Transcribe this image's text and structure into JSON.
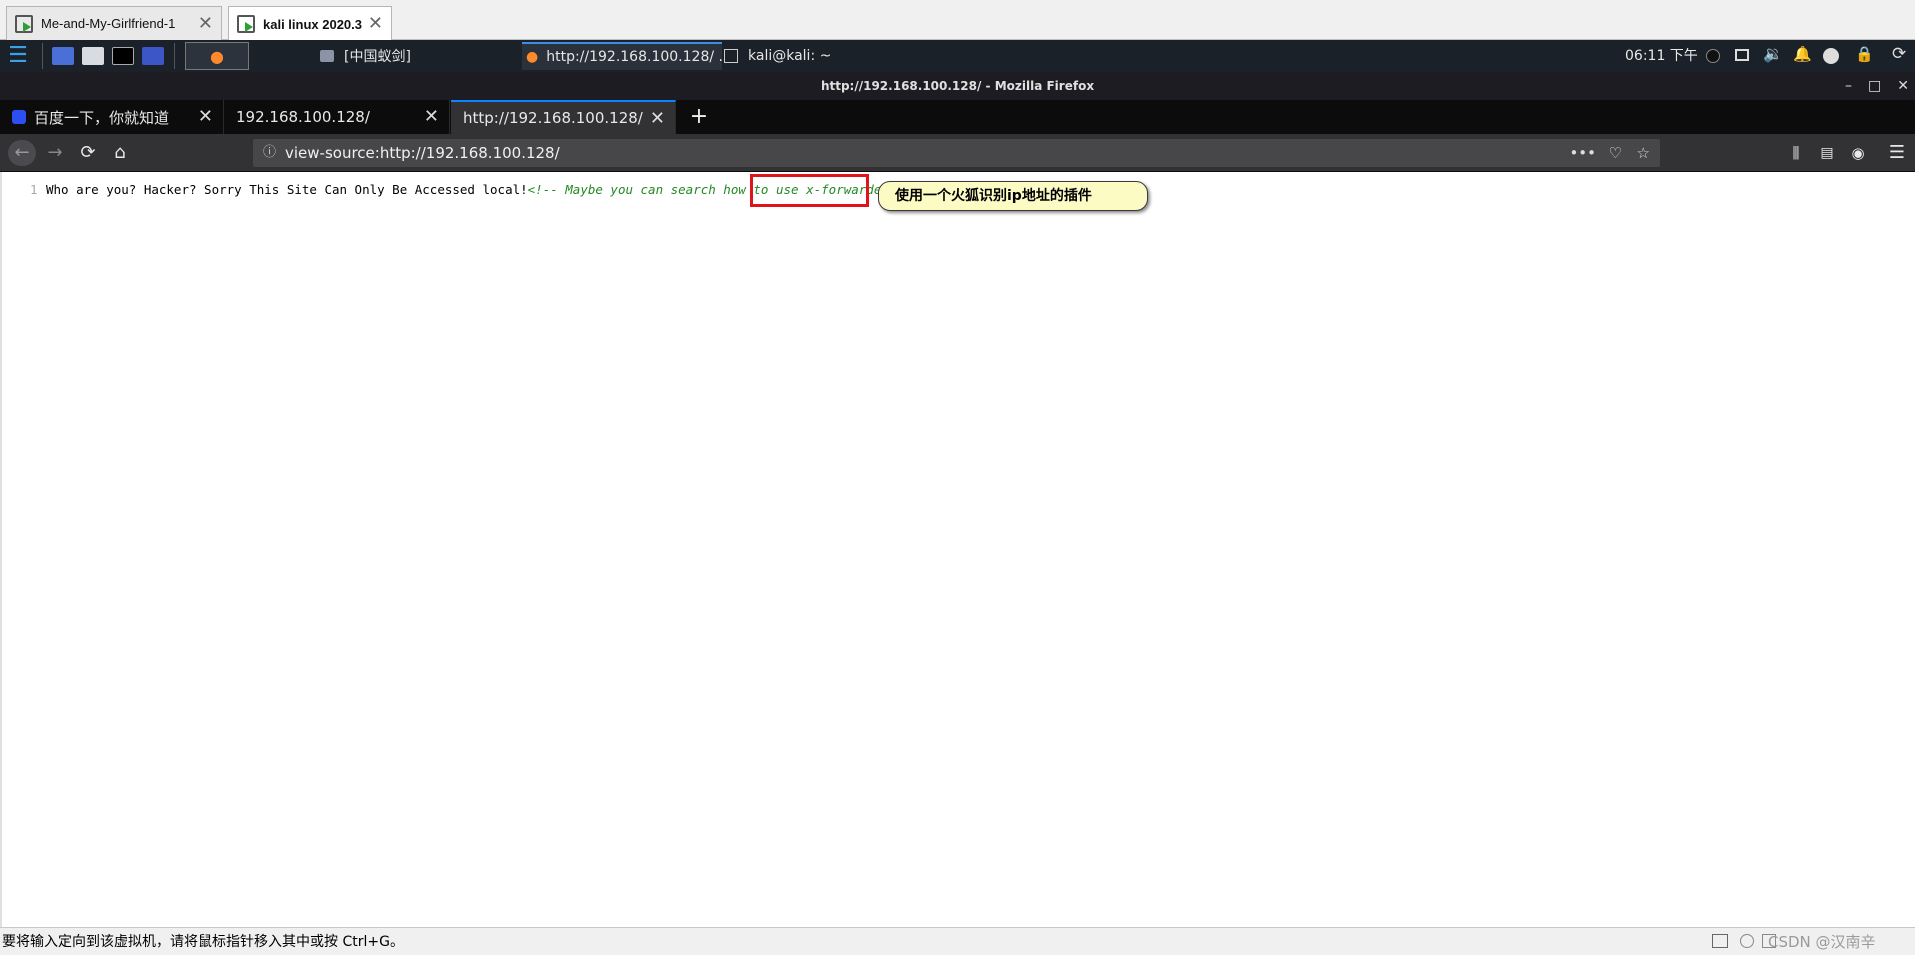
{
  "vm_tabs": [
    {
      "label": "Me-and-My-Girlfriend-1"
    },
    {
      "label": "kali linux 2020.3"
    }
  ],
  "panel": {
    "tasks": [
      {
        "label": "[中国蚁剑]"
      },
      {
        "label": "http://192.168.100.128/ ..."
      },
      {
        "label": "kali@kali: ~"
      }
    ],
    "clock": "06:11 下午"
  },
  "firefox": {
    "window_title": "http://192.168.100.128/ - Mozilla Firefox",
    "tabs": [
      {
        "label": "百度一下，你就知道"
      },
      {
        "label": "192.168.100.128/"
      },
      {
        "label": "http://192.168.100.128/"
      }
    ],
    "url": "view-source:http://192.168.100.128/"
  },
  "source": {
    "line_number": "1",
    "text_plain": "Who are you? Hacker? Sorry This Site Can Only Be Accessed local!",
    "comment": "<!-- Maybe you can search how to use x-forwarded-for -->"
  },
  "annotation": {
    "callout": "使用一个火狐识别ip地址的插件",
    "highlight_color": "#e0121c"
  },
  "status": {
    "text": "要将输入定向到该虚拟机，请将鼠标指针移入其中或按 Ctrl+G。",
    "watermark": "CSDN @汉南辛"
  }
}
